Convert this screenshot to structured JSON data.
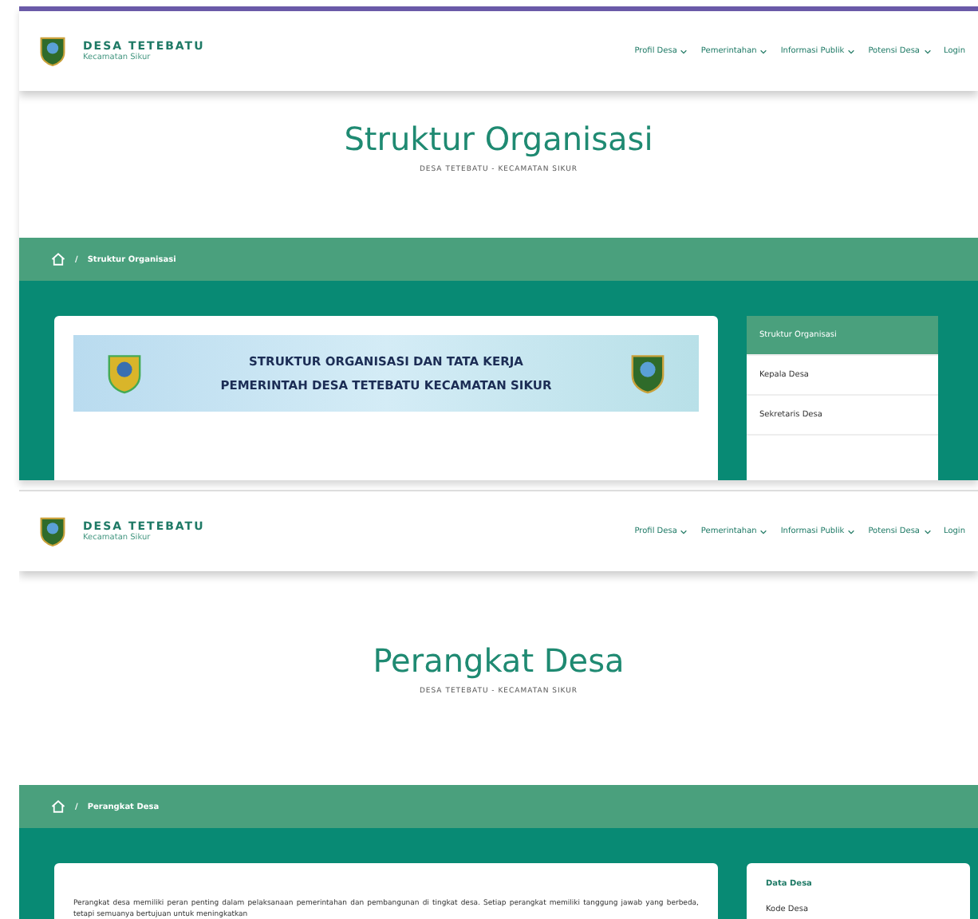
{
  "pages": [
    {
      "header": {
        "site_name": "DESA TETEBATU",
        "site_subtitle": "Kecamatan Sikur",
        "nav": [
          {
            "label": "Profil Desa",
            "dropdown": true
          },
          {
            "label": "Pemerintahan",
            "dropdown": true
          },
          {
            "label": "Informasi Publik",
            "dropdown": true
          },
          {
            "label": "Potensi Desa",
            "dropdown": true
          },
          {
            "label": "Login",
            "dropdown": false
          }
        ]
      },
      "title": "Struktur Organisasi",
      "subtitle": "DESA TETEBATU - KECAMATAN SIKUR",
      "breadcrumb_separator": "/",
      "breadcrumb": "Struktur Organisasi",
      "main": {
        "kind": "banner",
        "lines": [
          "STRUKTUR ORGANISASI DAN TATA KERJA",
          "PEMERINTAH DESA TETEBATU KECAMATAN SIKUR"
        ]
      },
      "sidebar": {
        "kind": "menu",
        "items": [
          {
            "label": "Struktur Organisasi",
            "selected": true
          },
          {
            "label": "Kepala Desa",
            "selected": false
          },
          {
            "label": "Sekretaris Desa",
            "selected": false
          }
        ]
      }
    },
    {
      "header": {
        "site_name": "DESA TETEBATU",
        "site_subtitle": "Kecamatan Sikur",
        "nav": [
          {
            "label": "Profil Desa",
            "dropdown": true
          },
          {
            "label": "Pemerintahan",
            "dropdown": true
          },
          {
            "label": "Informasi Publik",
            "dropdown": true
          },
          {
            "label": "Potensi Desa",
            "dropdown": true
          },
          {
            "label": "Login",
            "dropdown": false
          }
        ]
      },
      "title": "Perangkat Desa",
      "subtitle": "DESA TETEBATU - KECAMATAN SIKUR",
      "breadcrumb_separator": "/",
      "breadcrumb": "Perangkat Desa",
      "main": {
        "kind": "text",
        "text": "Perangkat desa memiliki peran penting dalam pelaksanaan pemerintahan dan pembangunan di tingkat desa. Setiap perangkat memiliki tanggung jawab yang berbeda, tetapi semuanya bertujuan untuk meningkatkan"
      },
      "sidebar": {
        "kind": "info",
        "title": "Data Desa",
        "rows": [
          {
            "label": "Kode Desa"
          }
        ]
      }
    }
  ]
}
